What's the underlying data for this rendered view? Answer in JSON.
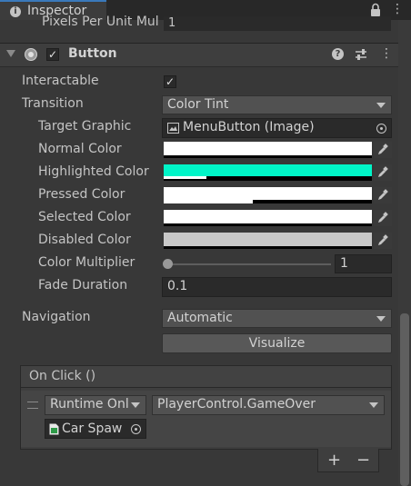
{
  "tab": {
    "title": "Inspector"
  },
  "partial_row": {
    "label": "Pixels Per Unit Mul",
    "value": "1"
  },
  "component": {
    "title": "Button",
    "enabled": true
  },
  "props": {
    "interactable": {
      "label": "Interactable",
      "checked": true
    },
    "transition": {
      "label": "Transition",
      "value": "Color Tint"
    },
    "target_graphic": {
      "label": "Target Graphic",
      "value": "MenuButton (Image)"
    },
    "normal_color": {
      "label": "Normal Color",
      "color": "#ffffff",
      "alpha": 0.0
    },
    "highlighted_color": {
      "label": "Highlighted Color",
      "color": "#00f5c8",
      "alpha": 0.2
    },
    "pressed_color": {
      "label": "Pressed Color",
      "color": "#ffffff",
      "alpha": 0.4
    },
    "selected_color": {
      "label": "Selected Color",
      "color": "#ffffff",
      "alpha": 0.0
    },
    "disabled_color": {
      "label": "Disabled Color",
      "color": "#c8c8c8",
      "alpha": 0.0
    },
    "color_multiplier": {
      "label": "Color Multiplier",
      "value": "1",
      "slider_fraction": 0.0
    },
    "fade_duration": {
      "label": "Fade Duration",
      "value": "0.1"
    },
    "navigation": {
      "label": "Navigation",
      "value": "Automatic"
    },
    "visualize": {
      "label": "Visualize"
    }
  },
  "onclick": {
    "title": "On Click ()",
    "runtime": "Runtime Onl",
    "function": "PlayerControl.GameOver",
    "object": "Car Spaw"
  },
  "footer": {
    "add": "+",
    "remove": "−"
  },
  "colors": {
    "bg": "#383838",
    "text": "#c4c4c4",
    "accent_tab": "#3a79bb"
  }
}
